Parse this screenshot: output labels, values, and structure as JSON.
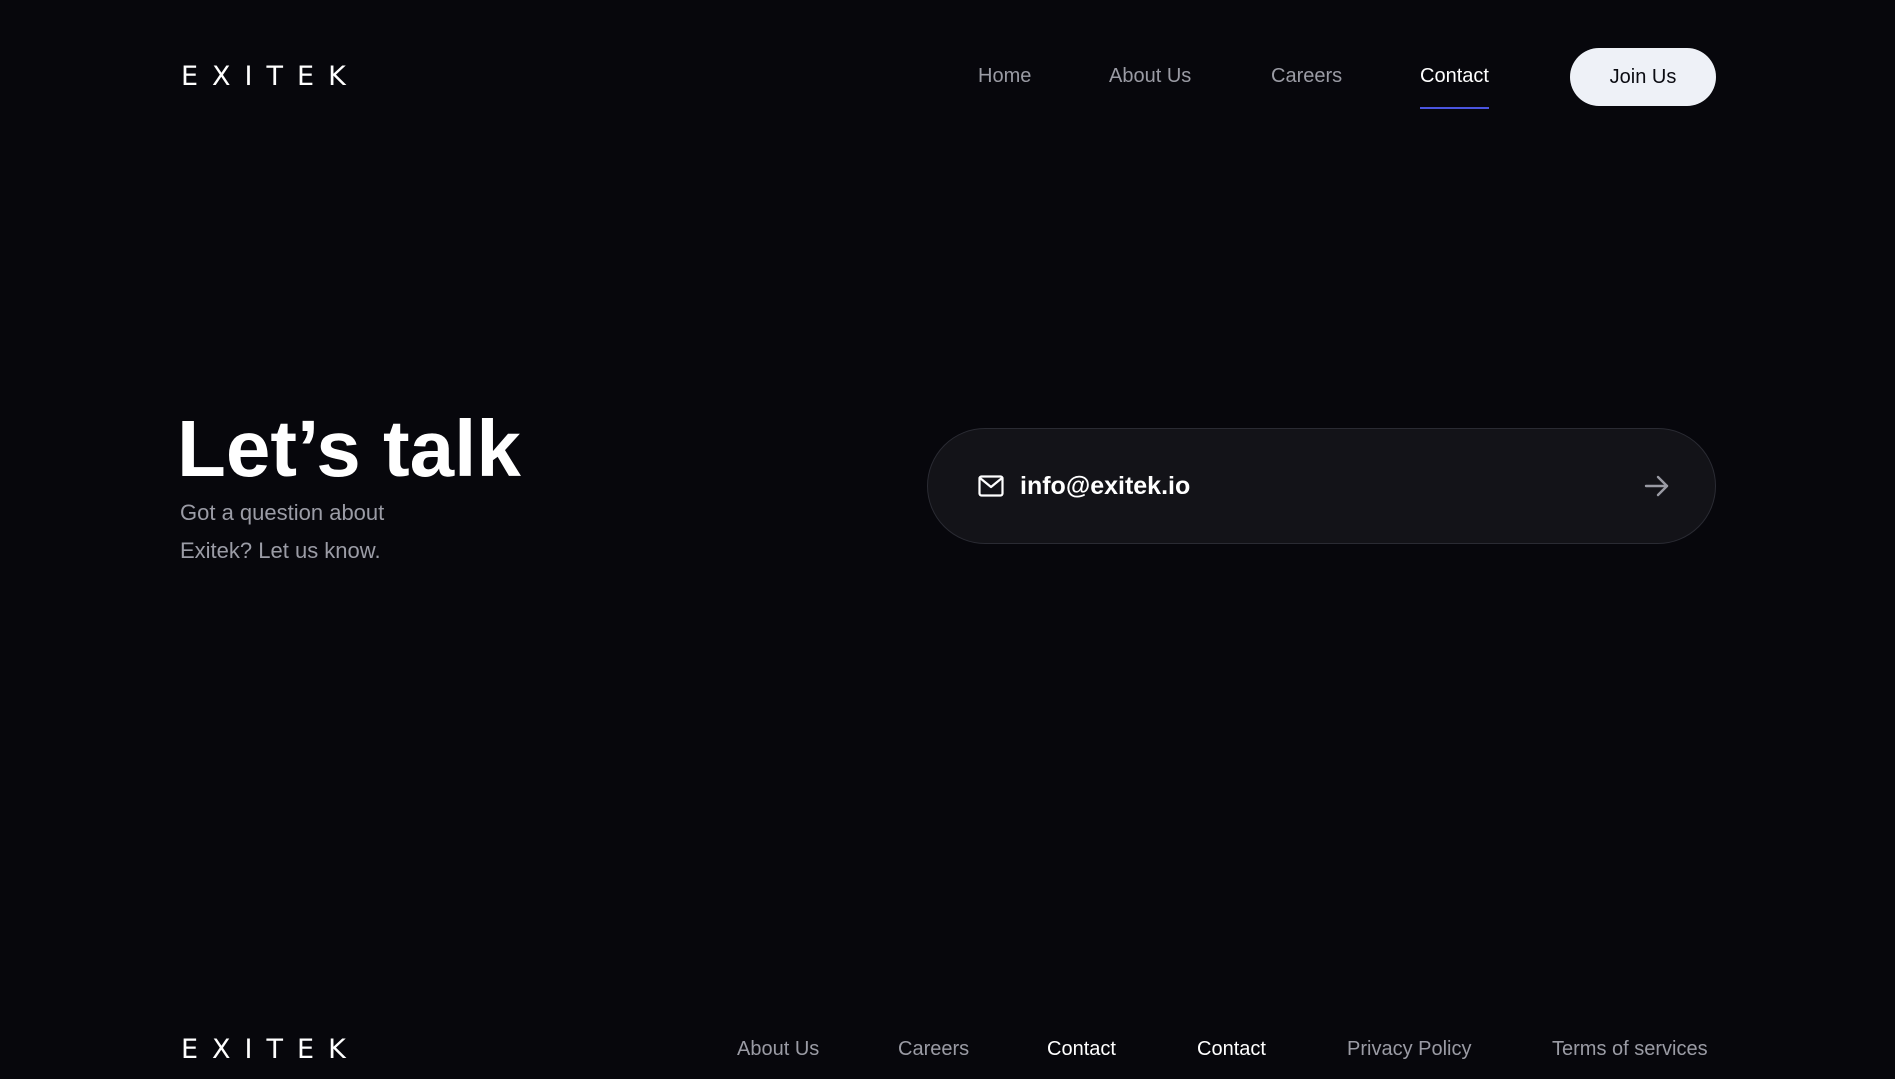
{
  "brand": {
    "logo_text": "EXITEK"
  },
  "nav": {
    "items": [
      {
        "label": "Home"
      },
      {
        "label": "About Us"
      },
      {
        "label": "Careers"
      },
      {
        "label": "Contact"
      }
    ],
    "active": "Contact",
    "join_label": "Join Us"
  },
  "hero": {
    "title": "Let’s talk",
    "subtitle": "Got a question about Exitek? Let us know."
  },
  "contact": {
    "email": "info@exitek.io",
    "email_icon": "mail-icon",
    "arrow_icon": "arrow-right-icon"
  },
  "footer": {
    "logo_text": "EXITEK",
    "links": [
      {
        "label": "About Us"
      },
      {
        "label": "Careers"
      },
      {
        "label": "Contact"
      },
      {
        "label": "Contact"
      },
      {
        "label": "Privacy Policy"
      },
      {
        "label": "Terms of services"
      }
    ]
  },
  "colors": {
    "background": "#07070c",
    "accent_underline": "#4a55e0",
    "muted_text": "#9a9ba4",
    "card_bg": "#131318",
    "button_bg": "#eef1f7"
  }
}
